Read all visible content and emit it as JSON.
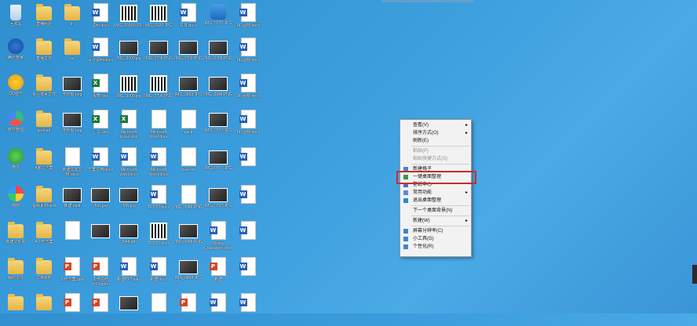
{
  "desktop": {
    "columns": [
      [
        {
          "label": "回收站",
          "kind": "recycle"
        },
        {
          "label": "腾讯管家",
          "kind": "app",
          "color": "c1"
        },
        {
          "label": "QQ音乐",
          "kind": "app",
          "color": "c5"
        },
        {
          "label": "软件管理",
          "kind": "app",
          "color": "c3"
        },
        {
          "label": "微信",
          "kind": "app",
          "color": "c4"
        },
        {
          "label": "画图",
          "kind": "app",
          "color": "c2"
        },
        {
          "label": "新建文件夹",
          "kind": "folder"
        },
        {
          "label": "我的文件",
          "kind": "folder"
        },
        {
          "label": "",
          "kind": "folder"
        }
      ],
      [
        {
          "label": "直播经验",
          "kind": "folder"
        },
        {
          "label": "直播文件",
          "kind": "folder"
        },
        {
          "label": "专业技术文件",
          "kind": "folder"
        },
        {
          "label": "preload",
          "kind": "folder"
        },
        {
          "label": "A客户方案",
          "kind": "folder"
        },
        {
          "label": "视频素材mp4",
          "kind": "folder"
        },
        {
          "label": "A工作方案",
          "kind": "folder"
        },
        {
          "label": "文档资料",
          "kind": "folder"
        },
        {
          "label": "",
          "kind": "folder"
        }
      ],
      [
        {
          "label": "ln",
          "kind": "folder"
        },
        {
          "label": "pe",
          "kind": "folder"
        },
        {
          "label": "无标题.png",
          "kind": "image"
        },
        {
          "label": "无标题.png",
          "kind": "image"
        },
        {
          "label": "新建文本文档.docx",
          "kind": "file"
        },
        {
          "label": "新建.mp4",
          "kind": "image"
        },
        {
          "label": "",
          "kind": "file"
        },
        {
          "label": "工作方案.pptx",
          "kind": "ppt"
        },
        {
          "label": "",
          "kind": "ppt"
        }
      ],
      [
        {
          "label": "说明.docx",
          "kind": "word"
        },
        {
          "label": "设计说明.docx",
          "kind": "word"
        },
        {
          "label": "报表.xlsx",
          "kind": "excel"
        },
        {
          "label": "汇总.xlsx",
          "kind": "excel"
        },
        {
          "label": "方案文档.docx",
          "kind": "word"
        },
        {
          "label": "IMG.jpg",
          "kind": "image"
        },
        {
          "label": "",
          "kind": "image"
        },
        {
          "label": "工作总结PPT.pptx",
          "kind": "ppt"
        },
        {
          "label": "",
          "kind": "ppt"
        }
      ],
      [
        {
          "label": "IMG_20201029.jpg",
          "kind": "qr"
        },
        {
          "label": "IMG_3000.jpg",
          "kind": "image"
        },
        {
          "label": "IMG_3000.jpg",
          "kind": "qr"
        },
        {
          "label": "Microsoft Excel.xlsx",
          "kind": "excel"
        },
        {
          "label": "Microsoft Word.docx",
          "kind": "word"
        },
        {
          "label": "IMG.jpg",
          "kind": "image"
        },
        {
          "label": "2048.pdf",
          "kind": "image"
        },
        {
          "label": "新建PPT.pptx",
          "kind": "word"
        },
        {
          "label": "",
          "kind": "image"
        }
      ],
      [
        {
          "label": "IMG_2020.JPG",
          "kind": "qr"
        },
        {
          "label": "IMG_3798.PNG",
          "kind": "image"
        },
        {
          "label": "IMG_3798.PNG",
          "kind": "qr"
        },
        {
          "label": "Microsoft Word.docx",
          "kind": "file"
        },
        {
          "label": "Microsoft Word.docx",
          "kind": "word"
        },
        {
          "label": "TRC97.docx",
          "kind": "word"
        },
        {
          "label": "TRC97.docx",
          "kind": "qr"
        },
        {
          "label": "新建.docx",
          "kind": "word"
        },
        {
          "label": "",
          "kind": "file"
        }
      ],
      [
        {
          "label": "1111.docx",
          "kind": "word"
        },
        {
          "label": "IMG_3799.PNG",
          "kind": "image"
        },
        {
          "label": "IMG_3668.JPG",
          "kind": "image"
        },
        {
          "label": "pack",
          "kind": "file"
        },
        {
          "label": "pack.txt",
          "kind": "file"
        },
        {
          "label": "IMG_0848.PNG",
          "kind": "file"
        },
        {
          "label": "IMG_0848.PNG",
          "kind": "image"
        },
        {
          "label": "IMG_0808.JPG",
          "kind": "image"
        },
        {
          "label": "",
          "kind": "ppt"
        }
      ],
      [
        {
          "label": "IMG_0770.JPG",
          "kind": "app",
          "color": "c6"
        },
        {
          "label": "IMG_0288.PNG",
          "kind": "image"
        },
        {
          "label": "IMG_0848.PNG",
          "kind": "image"
        },
        {
          "label": "IMG_0707.JPG",
          "kind": "image"
        },
        {
          "label": "IMG_0707.JPG",
          "kind": "image"
        },
        {
          "label": "IMG_0797.JPG",
          "kind": "image"
        },
        {
          "label": "Disney Characters.docx",
          "kind": "word"
        },
        {
          "label": "新建",
          "kind": "ppt"
        },
        {
          "label": "",
          "kind": "word"
        }
      ],
      [
        {
          "label": "14_图标.docx",
          "kind": "word"
        },
        {
          "label": "14_图标.docx",
          "kind": "word"
        },
        {
          "label": "14_图标.docx",
          "kind": "word"
        },
        {
          "label": "14_图标.docx",
          "kind": "word"
        },
        {
          "label": "",
          "kind": "word"
        },
        {
          "label": "",
          "kind": "word"
        },
        {
          "label": "",
          "kind": "word"
        },
        {
          "label": "",
          "kind": "word"
        },
        {
          "label": "",
          "kind": "word"
        }
      ]
    ]
  },
  "context_menu": {
    "items": [
      {
        "label": "查看(V)",
        "submenu": true,
        "disabled": false
      },
      {
        "label": "排序方式(O)",
        "submenu": true,
        "disabled": false
      },
      {
        "label": "刷新(E)",
        "submenu": false,
        "disabled": false
      },
      {
        "sep": true
      },
      {
        "label": "粘贴(P)",
        "submenu": false,
        "disabled": true
      },
      {
        "label": "粘贴快捷方式(S)",
        "submenu": false,
        "disabled": true
      },
      {
        "sep": true
      },
      {
        "label": "新建格子",
        "submenu": false,
        "disabled": false,
        "icon": "#3a87d4"
      },
      {
        "label": "一键桌面整理",
        "submenu": false,
        "disabled": false,
        "icon": "#2f9b4a"
      },
      {
        "label": "壁纸中心",
        "submenu": false,
        "disabled": false,
        "icon": "#4a6fd1"
      },
      {
        "label": "常用功能",
        "submenu": true,
        "disabled": false,
        "icon": "#5b8dd6"
      },
      {
        "label": "退出桌面整理",
        "submenu": false,
        "disabled": false,
        "icon": "#2b8ad1"
      },
      {
        "sep": true
      },
      {
        "label": "下一个桌面背景(N)",
        "submenu": false,
        "disabled": false
      },
      {
        "sep": true
      },
      {
        "label": "新建(W)",
        "submenu": true,
        "disabled": false
      },
      {
        "sep": true
      },
      {
        "label": "屏幕分辨率(C)",
        "submenu": false,
        "disabled": false,
        "icon": "#3a87d4"
      },
      {
        "label": "小工具(G)",
        "submenu": false,
        "disabled": false,
        "icon": "#3a87d4"
      },
      {
        "label": "个性化(R)",
        "submenu": false,
        "disabled": false,
        "icon": "#3a87d4"
      }
    ],
    "highlighted": [
      "新建格子",
      "一键桌面整理"
    ],
    "highlight_color": "#d02a2a"
  }
}
